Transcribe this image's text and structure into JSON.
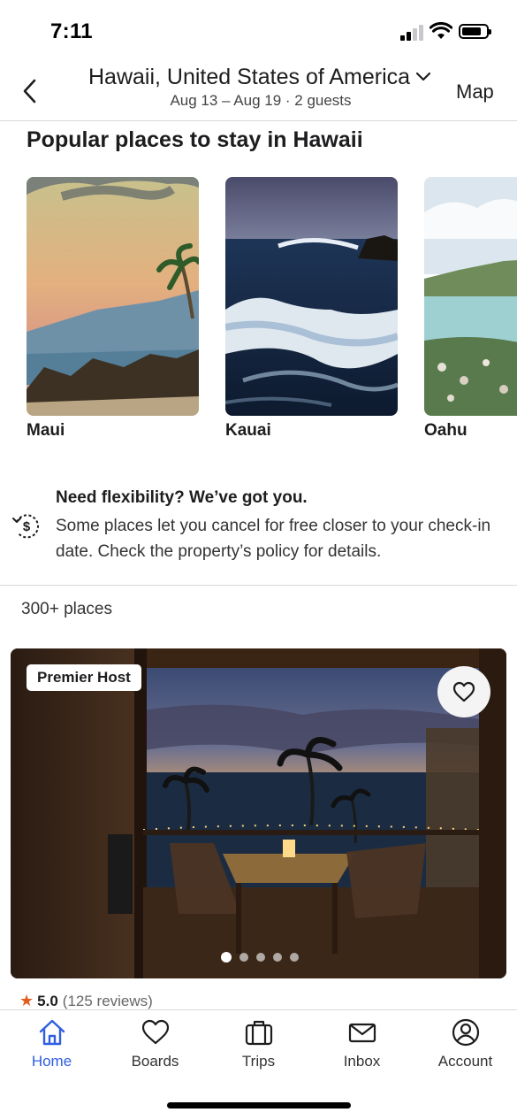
{
  "status_bar": {
    "time": "7:11",
    "battery_level": 0.8
  },
  "header": {
    "title": "Hawaii, United States of America",
    "subtitle": "Aug 13 – Aug 19 · 2 guests",
    "map_label": "Map",
    "back_icon": "chevron-left-icon",
    "dropdown_icon": "chevron-down-icon"
  },
  "popular": {
    "title": "Popular places to stay in Hawaii",
    "places": [
      {
        "name": "Maui"
      },
      {
        "name": "Kauai"
      },
      {
        "name": "Oahu"
      }
    ]
  },
  "flexibility": {
    "icon": "refund-clock-icon",
    "title": "Need flexibility? We’ve got you.",
    "text": "Some places let you cancel for free closer to your check-in date. Check the property’s policy for details."
  },
  "results": {
    "count": "300+ places"
  },
  "listing": {
    "badge": "Premier Host",
    "rating": "5.0",
    "reviews": "(125 reviews)",
    "photo_count": 5,
    "active_photo": 1
  },
  "tabbar": {
    "tabs": [
      {
        "label": "Home",
        "icon": "home-icon",
        "active": true
      },
      {
        "label": "Boards",
        "icon": "heart-icon",
        "active": false
      },
      {
        "label": "Trips",
        "icon": "suitcase-icon",
        "active": false
      },
      {
        "label": "Inbox",
        "icon": "envelope-icon",
        "active": false
      },
      {
        "label": "Account",
        "icon": "account-icon",
        "active": false
      }
    ]
  },
  "colors": {
    "accent": "#2f5ee0",
    "star": "#e35d21",
    "divider": "#d9d9de"
  }
}
